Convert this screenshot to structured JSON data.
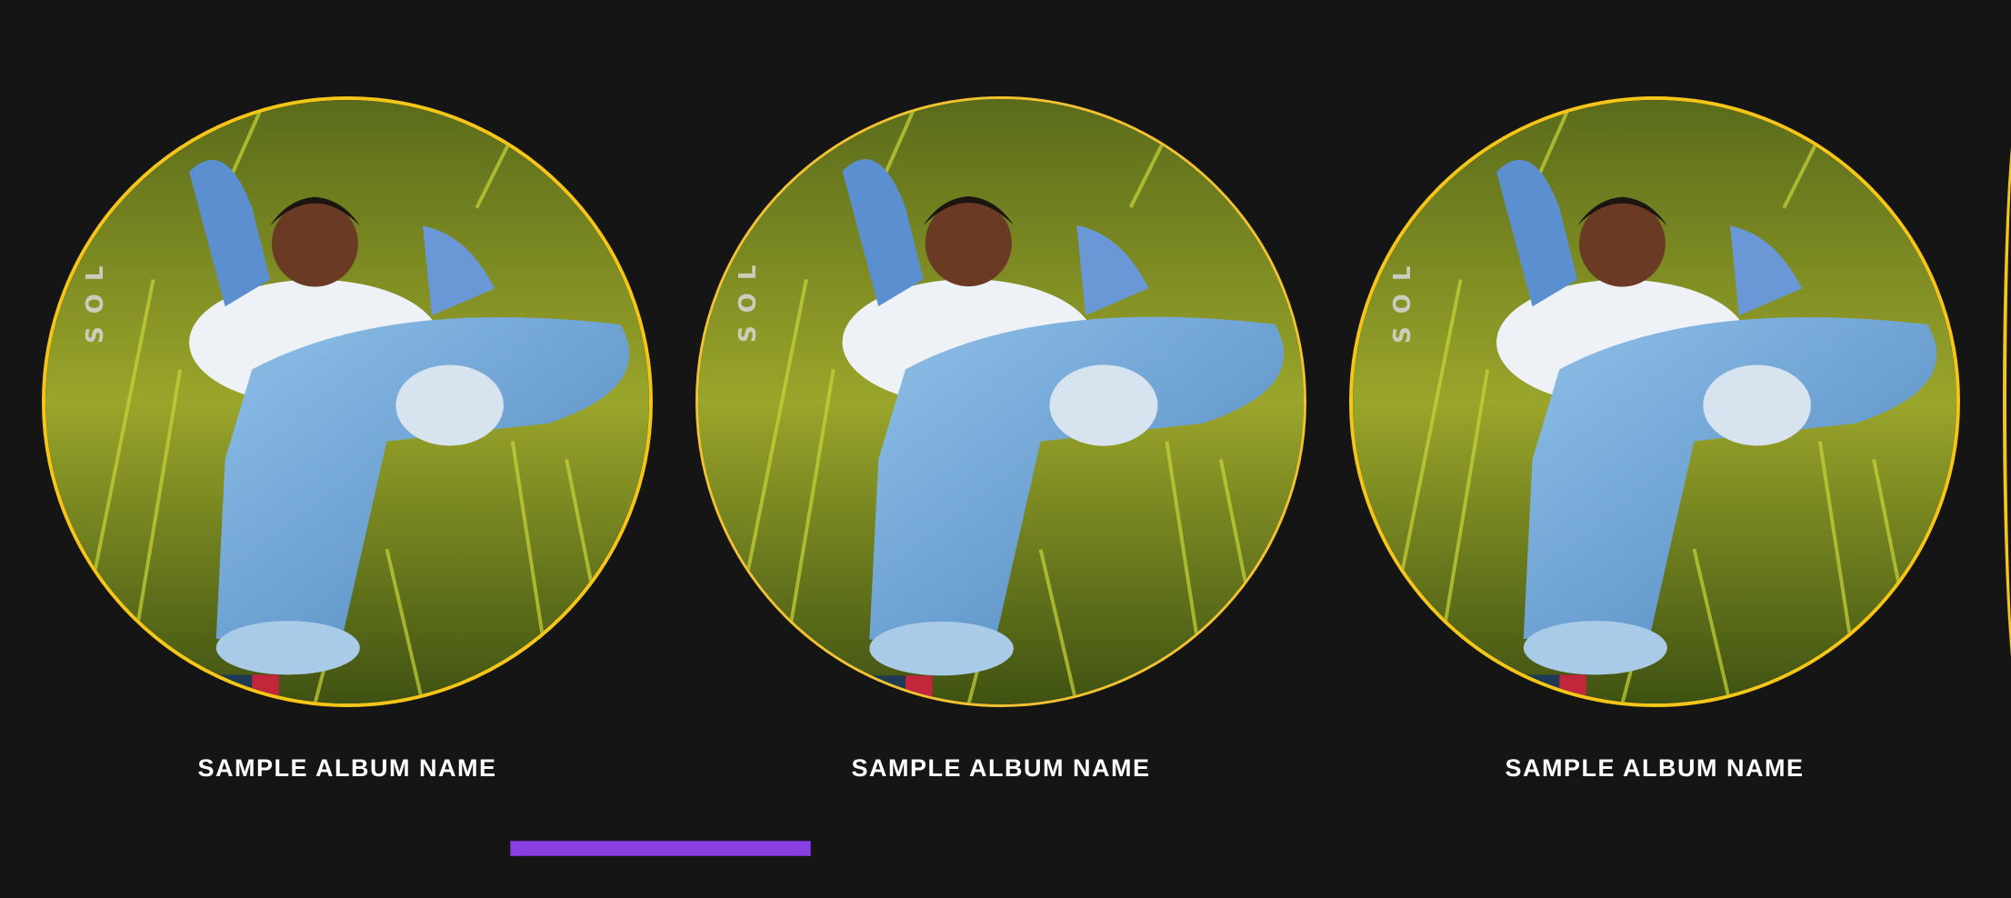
{
  "albums": [
    {
      "name": "SAMPLE ALBUM NAME",
      "cover_text": "SOL"
    },
    {
      "name": "SAMPLE ALBUM NAME",
      "cover_text": "SOL"
    },
    {
      "name": "SAMPLE ALBUM NAME",
      "cover_text": "SOL"
    }
  ],
  "colors": {
    "background": "#151515",
    "ring": "#f5c518",
    "progress": "#8a3fe0",
    "label": "#ffffff"
  },
  "scroll_progress": 0.33
}
